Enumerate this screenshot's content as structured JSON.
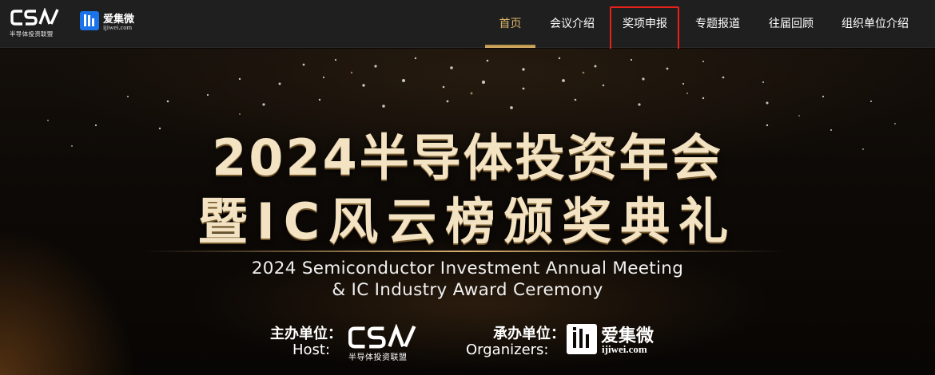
{
  "header": {
    "csia_logo": {
      "mark": "CSIA",
      "subtitle": "半导体投资联盟"
    },
    "ijiwei_logo": {
      "name": "爱集微",
      "domain": "ijiwei.com"
    }
  },
  "nav": {
    "items": [
      {
        "label": "首页",
        "active": true
      },
      {
        "label": "会议介绍"
      },
      {
        "label": "奖项申报",
        "highlighted": true
      },
      {
        "label": "专题报道"
      },
      {
        "label": "往届回顾"
      },
      {
        "label": "组织单位介绍"
      }
    ],
    "active_color": "#d9b46a",
    "highlight_color": "#e5211a"
  },
  "hero": {
    "title_cn_line1": "2024半导体投资年会",
    "title_cn_line2": "暨IC风云榜颁奖典礼",
    "title_en_line1": "2024 Semiconductor Investment Annual Meeting",
    "title_en_line2": "&  IC Industry Award Ceremony",
    "host": {
      "label_cn": "主办单位：",
      "label_en": "Host:",
      "logo_mark": "CSIA",
      "logo_subtitle": "半导体投资联盟"
    },
    "organizer": {
      "label_cn": "承办单位：",
      "label_en": "Organizers:",
      "logo_name": "爱集微",
      "logo_domain": "ijiwei.com"
    }
  }
}
